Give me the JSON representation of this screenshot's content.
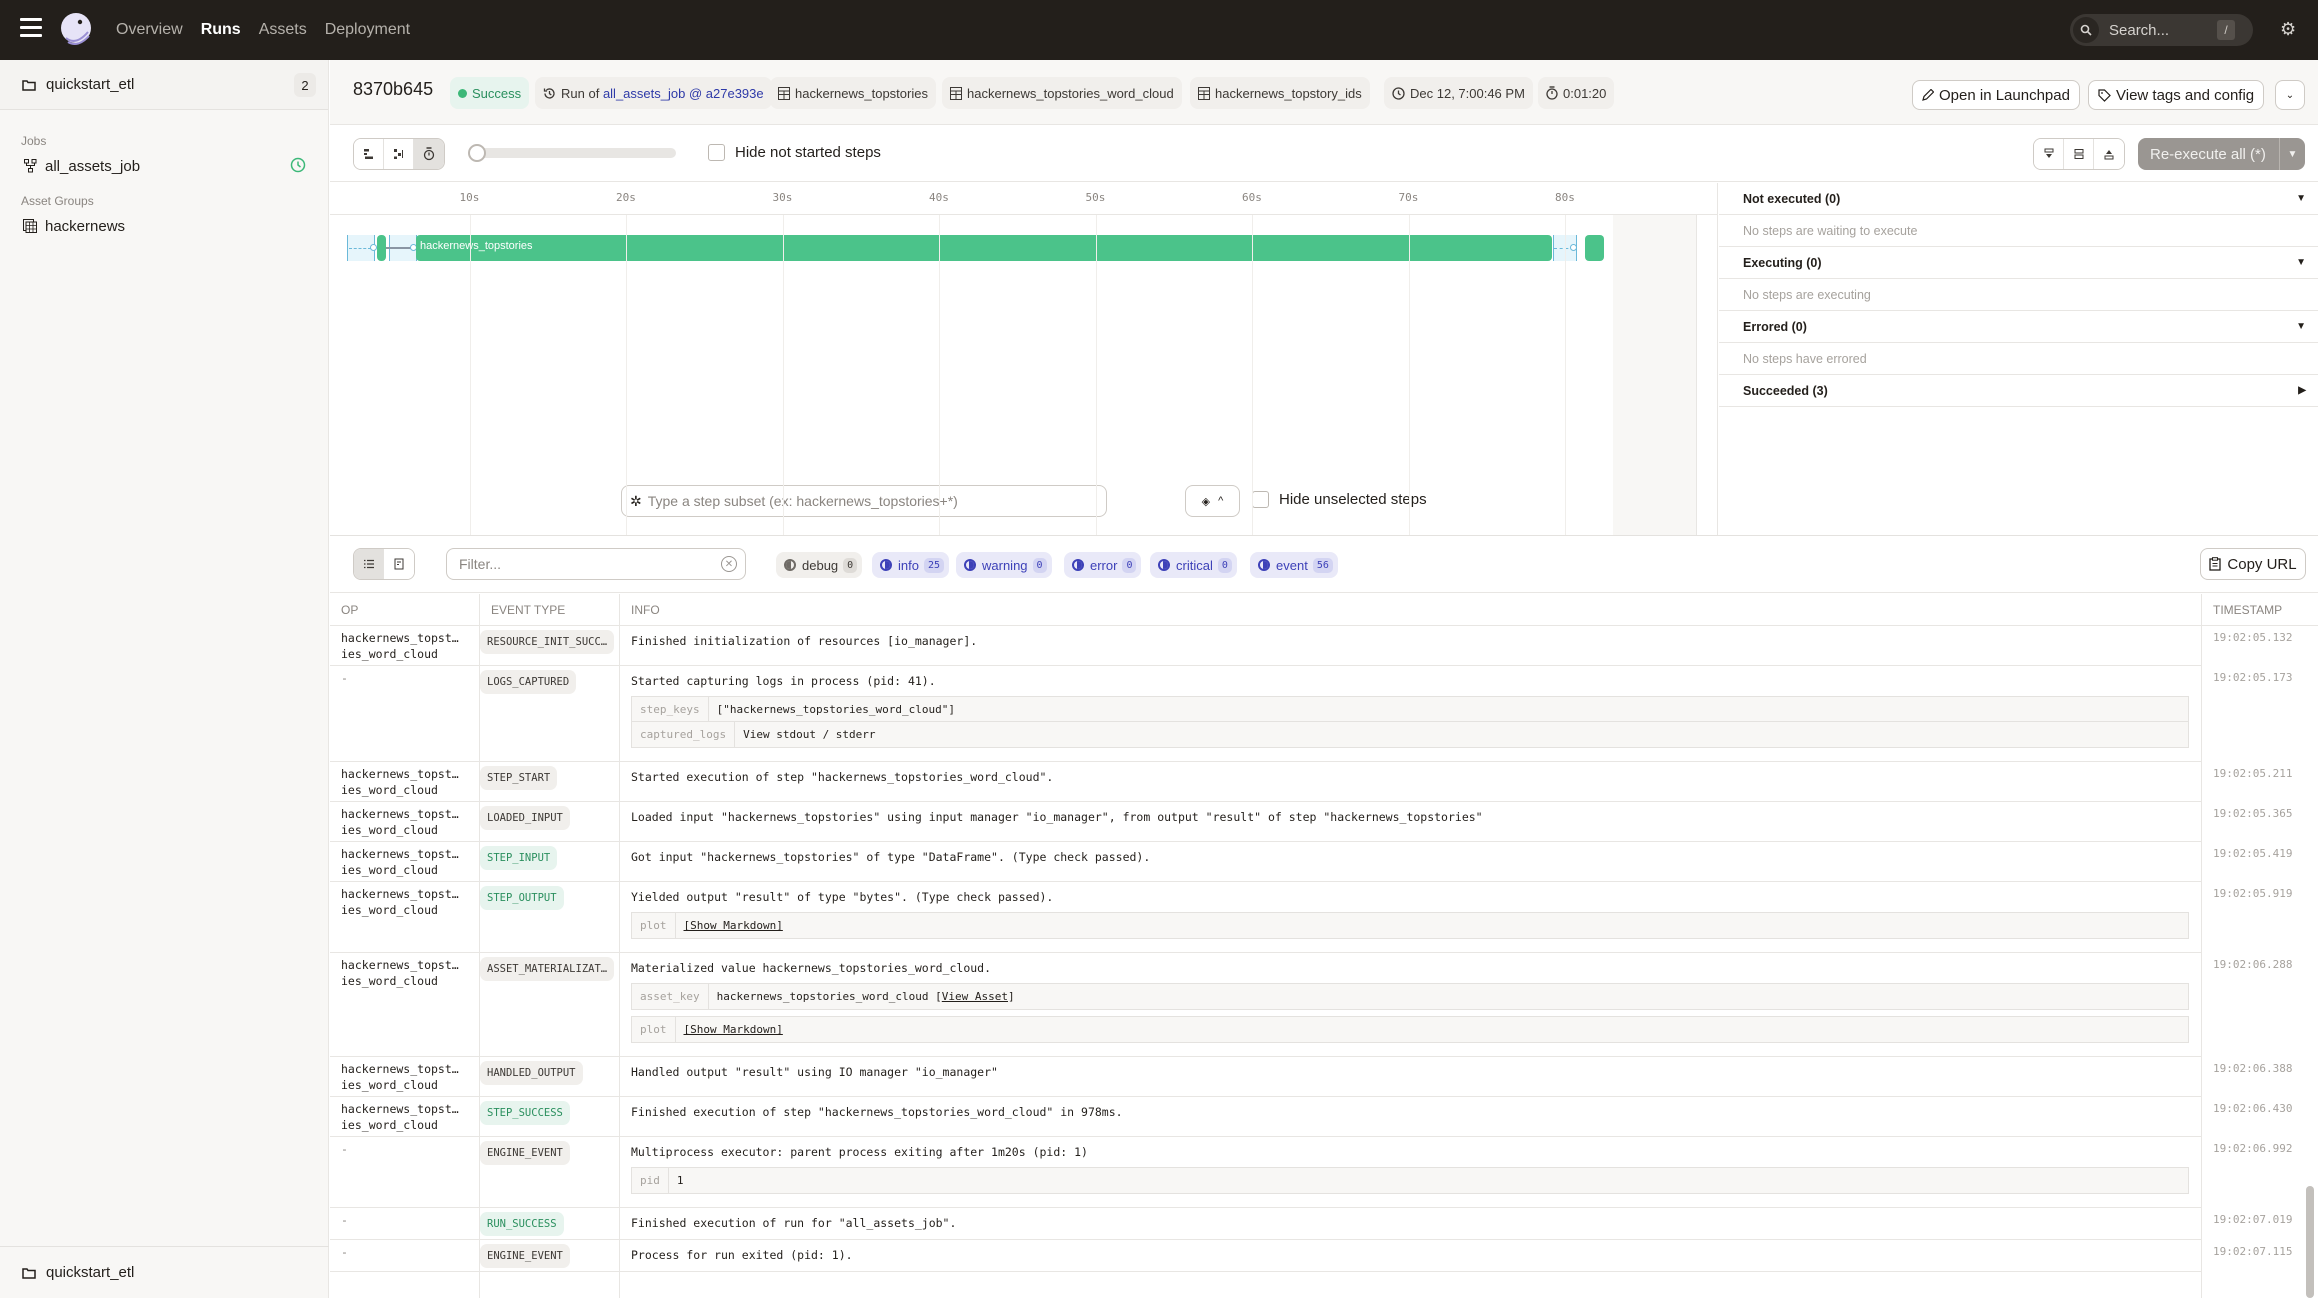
{
  "nav": {
    "links": [
      "Overview",
      "Runs",
      "Assets",
      "Deployment"
    ],
    "active": "Runs",
    "search_placeholder": "Search...",
    "search_shortcut": "/"
  },
  "sidebar": {
    "repo": {
      "name": "quickstart_etl",
      "count": "2"
    },
    "jobs_heading": "Jobs",
    "jobs": [
      {
        "label": "all_assets_job",
        "icon": "job-graph-icon",
        "status_icon": "schedule-clock-icon"
      }
    ],
    "asset_groups_heading": "Asset Groups",
    "asset_groups": [
      {
        "label": "hackernews",
        "icon": "asset-group-icon"
      }
    ],
    "bottom_repo": "quickstart_etl"
  },
  "run": {
    "id": "8370b645",
    "status": "Success",
    "run_of_prefix": "Run of",
    "job": "all_assets_job",
    "at": "@",
    "snapshot": "a27e393e",
    "assets": [
      "hackernews_topstories",
      "hackernews_topstories_word_cloud",
      "hackernews_topstory_ids"
    ],
    "started": "Dec 12, 7:00:46 PM",
    "duration": "0:01:20",
    "open_launchpad": "Open in Launchpad",
    "view_tags": "View tags and config"
  },
  "toolbar": {
    "hide_not_started": "Hide not started steps",
    "reexecute": "Re-execute all (*)",
    "zoom_slider_value": 0
  },
  "gantt": {
    "ticks": [
      "10s",
      "20s",
      "30s",
      "40s",
      "50s",
      "60s",
      "70s",
      "80s"
    ],
    "main_step": "hackernews_topstories",
    "subset_placeholder": "Type a step subset (ex: hackernews_topstories+*)",
    "hide_unselected": "Hide unselected steps"
  },
  "step_status": [
    {
      "label": "Not executed (0)",
      "empty": "No steps are waiting to execute",
      "expanded": true
    },
    {
      "label": "Executing (0)",
      "empty": "No steps are executing",
      "expanded": true
    },
    {
      "label": "Errored (0)",
      "empty": "No steps have errored",
      "expanded": true
    },
    {
      "label": "Succeeded (3)",
      "empty": null,
      "expanded": false
    }
  ],
  "logs": {
    "filter_placeholder": "Filter...",
    "levels": [
      {
        "name": "debug",
        "count": "0",
        "enabled": false
      },
      {
        "name": "info",
        "count": "25",
        "enabled": true
      },
      {
        "name": "warning",
        "count": "0",
        "enabled": true
      },
      {
        "name": "error",
        "count": "0",
        "enabled": true
      },
      {
        "name": "critical",
        "count": "0",
        "enabled": true
      },
      {
        "name": "event",
        "count": "56",
        "enabled": true
      }
    ],
    "copy_url": "Copy URL",
    "columns": [
      "OP",
      "EVENT TYPE",
      "INFO",
      "TIMESTAMP"
    ],
    "rows": [
      {
        "op": "hackernews_topst…\nies_word_cloud",
        "type": "RESOURCE_INIT_SUCC…",
        "green": false,
        "info": "Finished initialization of resources [io_manager].",
        "ts": "19:02:05.132",
        "meta": []
      },
      {
        "op": "-",
        "type": "LOGS_CAPTURED",
        "green": false,
        "info": "Started capturing logs in process (pid: 41).",
        "ts": "19:02:05.173",
        "meta": [
          [
            {
              "k": "step_keys",
              "v": "[\"hackernews_topstories_word_cloud\"]"
            },
            {
              "k": "captured_logs",
              "v": "View stdout / stderr"
            }
          ]
        ]
      },
      {
        "op": "hackernews_topst…\nies_word_cloud",
        "type": "STEP_START",
        "green": false,
        "info": "Started execution of step \"hackernews_topstories_word_cloud\".",
        "ts": "19:02:05.211",
        "meta": []
      },
      {
        "op": "hackernews_topst…\nies_word_cloud",
        "type": "LOADED_INPUT",
        "green": false,
        "info": "Loaded input \"hackernews_topstories\" using input manager \"io_manager\", from output \"result\" of step \"hackernews_topstories\"",
        "ts": "19:02:05.365",
        "meta": []
      },
      {
        "op": "hackernews_topst…\nies_word_cloud",
        "type": "STEP_INPUT",
        "green": true,
        "info": "Got input \"hackernews_topstories\" of type \"DataFrame\". (Type check passed).",
        "ts": "19:02:05.419",
        "meta": []
      },
      {
        "op": "hackernews_topst…\nies_word_cloud",
        "type": "STEP_OUTPUT",
        "green": true,
        "info": "Yielded output \"result\" of type \"bytes\". (Type check passed).",
        "ts": "19:02:05.919",
        "meta": [
          [
            {
              "k": "plot",
              "v": "",
              "link": "[Show Markdown]"
            }
          ]
        ]
      },
      {
        "op": "hackernews_topst…\nies_word_cloud",
        "type": "ASSET_MATERIALIZAT…",
        "green": false,
        "info": "Materialized value hackernews_topstories_word_cloud.",
        "ts": "19:02:06.288",
        "meta": [
          [
            {
              "k": "asset_key",
              "v": "hackernews_topstories_word_cloud  [",
              "link": "View Asset",
              "after": "]"
            }
          ],
          [
            {
              "k": "plot",
              "v": "",
              "link": "[Show Markdown]"
            }
          ]
        ]
      },
      {
        "op": "hackernews_topst…\nies_word_cloud",
        "type": "HANDLED_OUTPUT",
        "green": false,
        "info": "Handled output \"result\" using IO manager \"io_manager\"",
        "ts": "19:02:06.388",
        "meta": []
      },
      {
        "op": "hackernews_topst…\nies_word_cloud",
        "type": "STEP_SUCCESS",
        "green": true,
        "info": "Finished execution of step \"hackernews_topstories_word_cloud\" in 978ms.",
        "ts": "19:02:06.430",
        "meta": []
      },
      {
        "op": "-",
        "type": "ENGINE_EVENT",
        "green": false,
        "info": "Multiprocess executor: parent process exiting after 1m20s (pid: 1)",
        "ts": "19:02:06.992",
        "meta": [
          [
            {
              "k": "pid",
              "v": "1"
            }
          ]
        ]
      },
      {
        "op": "-",
        "type": "RUN_SUCCESS",
        "green": true,
        "info": "Finished execution of run for \"all_assets_job\".",
        "ts": "19:02:07.019",
        "meta": []
      },
      {
        "op": "-",
        "type": "ENGINE_EVENT",
        "green": false,
        "info": "Process for run exited (pid: 1).",
        "ts": "19:02:07.115",
        "meta": []
      }
    ]
  },
  "colors": {
    "nav_bg": "#231f1b",
    "success_green": "#4bc38a",
    "link_blue": "#2e3aa8",
    "level_on": "#3d41b8"
  }
}
